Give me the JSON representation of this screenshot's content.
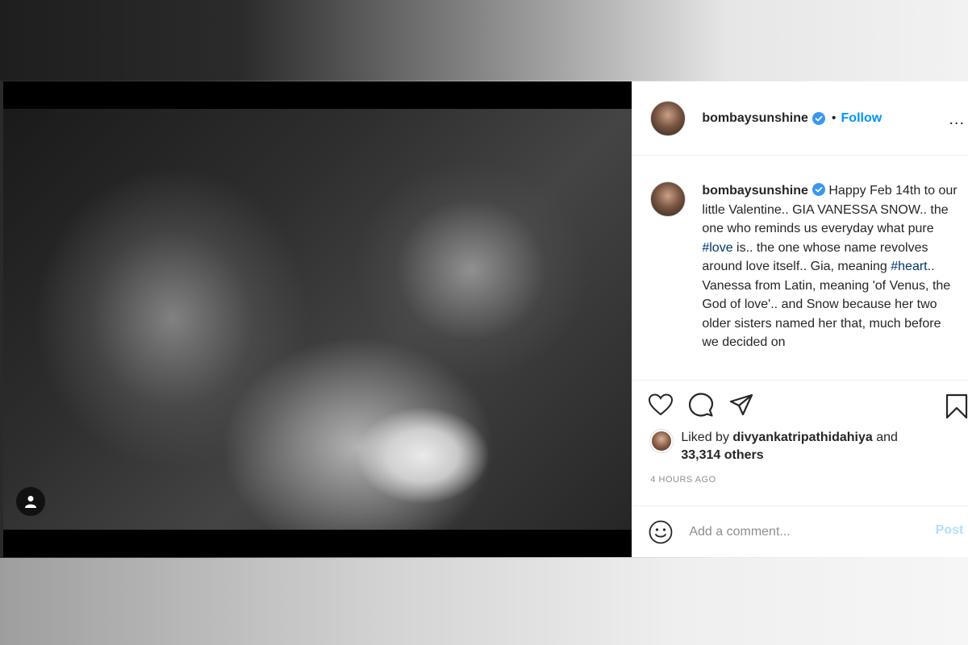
{
  "post": {
    "username": "bombaysunshine",
    "follow_label": "Follow",
    "separator": "•",
    "more_label": "...",
    "caption": {
      "username": "bombaysunshine",
      "line1": "Happy Feb 14th to our little Valentine.. GIA VANESSA SNOW.. the one who reminds us everyday what pure ",
      "hashtag1": "#love",
      "line2": " is.. the one whose name revolves around love itself.. Gia, meaning ",
      "hashtag2": "#heart",
      "line3": ".. Vanessa from Latin, meaning 'of Venus, the God of love'.. and Snow because her two older sisters named her that, much before we decided on"
    },
    "likes": {
      "prefix": "Liked by ",
      "user": "divyankatripathidahiya",
      "middle": " and ",
      "count": "33,314 others"
    },
    "timestamp": "4 HOURS AGO",
    "comment": {
      "placeholder": "Add a comment...",
      "post_label": "Post"
    }
  },
  "colors": {
    "accent": "#0095f6",
    "hashtag": "#00376b",
    "text": "#262626",
    "muted": "#8e8e8e"
  },
  "icons": [
    "verified-badge-icon",
    "heart-icon",
    "comment-icon",
    "share-icon",
    "bookmark-icon",
    "emoji-icon",
    "user-tag-icon",
    "more-options-icon"
  ]
}
